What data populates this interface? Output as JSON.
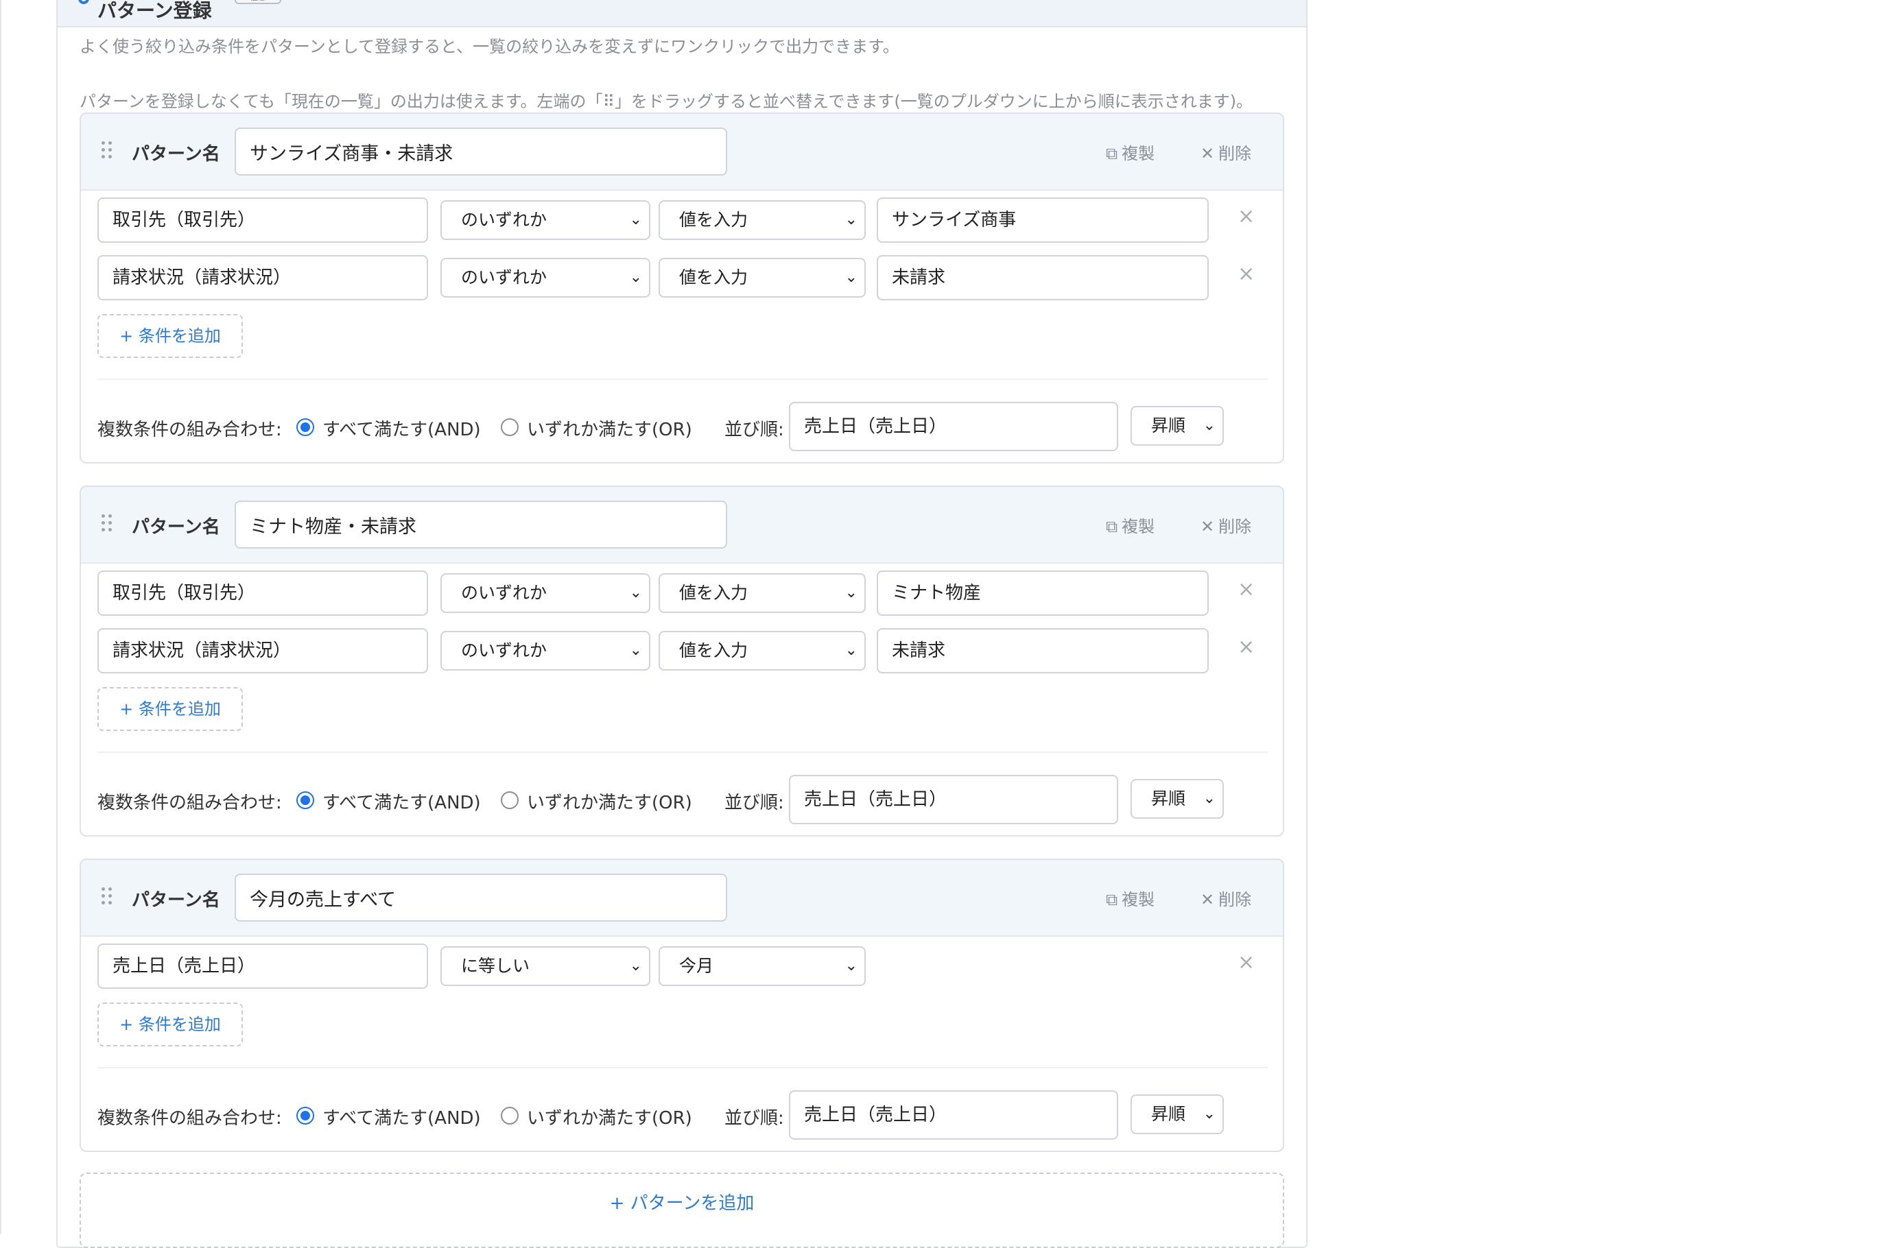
{
  "header": {
    "title": "パターン登録",
    "badge": "任意"
  },
  "description": {
    "line1": "よく使う絞り込み条件をパターンとして登録すると、一覧の絞り込みを変えずにワンクリックで出力できます。",
    "line2": "パターンを登録しなくても「現在の一覧」の出力は使えます。左端の「⠿」をドラッグすると並べ替えできます(一覧のプルダウンに上から順に表示されます)。"
  },
  "labels": {
    "pattern_name": "パターン名",
    "copy": "複製",
    "delete": "削除",
    "add_condition": "+ 条件を追加",
    "combination": "複数条件の組み合わせ:",
    "and": "すべて満たす(AND)",
    "or": "いずれか満たす(OR)",
    "sort": "並び順:",
    "add_pattern": "+ パターンを追加"
  },
  "patterns": [
    {
      "name": "サンライズ商事・未請求",
      "conditions": [
        {
          "field": "取引先（取引先）",
          "operator": "のいずれか",
          "mode": "値を入力",
          "value": "サンライズ商事"
        },
        {
          "field": "請求状況（請求状況）",
          "operator": "のいずれか",
          "mode": "値を入力",
          "value": "未請求"
        }
      ],
      "combination": "AND",
      "sort_field": "売上日（売上日）",
      "sort_order": "昇順"
    },
    {
      "name": "ミナト物産・未請求",
      "conditions": [
        {
          "field": "取引先（取引先）",
          "operator": "のいずれか",
          "mode": "値を入力",
          "value": "ミナト物産"
        },
        {
          "field": "請求状況（請求状況）",
          "operator": "のいずれか",
          "mode": "値を入力",
          "value": "未請求"
        }
      ],
      "combination": "AND",
      "sort_field": "売上日（売上日）",
      "sort_order": "昇順"
    },
    {
      "name": "今月の売上すべて",
      "conditions": [
        {
          "field": "売上日（売上日）",
          "operator": "に等しい",
          "mode": "今月",
          "value": ""
        }
      ],
      "combination": "AND",
      "sort_field": "売上日（売上日）",
      "sort_order": "昇順"
    }
  ],
  "colors": {
    "accent": "#1e73e8",
    "link": "#2a7ad6",
    "header_bg": "#eef3fa",
    "card_head_bg": "#f1f6fb"
  },
  "icons": {
    "drag": "drag-handle-icon",
    "copy": "copy-icon",
    "delete": "close-icon",
    "chevron": "chevron-down-icon"
  }
}
